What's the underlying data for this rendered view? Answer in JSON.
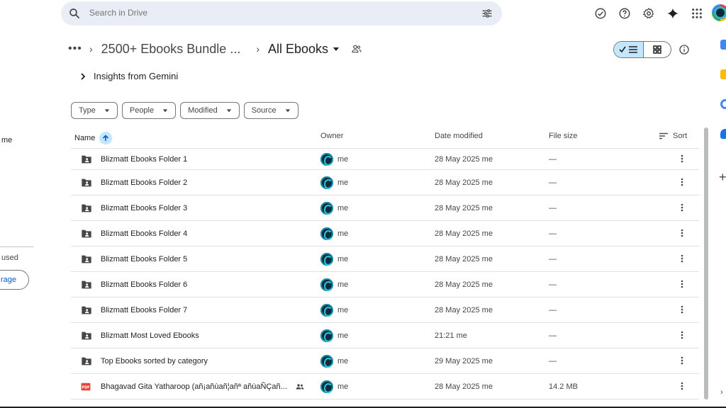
{
  "search": {
    "placeholder": "Search in Drive"
  },
  "sidebar": {
    "shared_label": "me",
    "storage_used": "used",
    "storage_button": "rage"
  },
  "breadcrumb": {
    "parent": "2500+ Ebooks Bundle ...",
    "current": "All Ebooks"
  },
  "gemini": {
    "label": "Insights from Gemini"
  },
  "filters": [
    {
      "label": "Type"
    },
    {
      "label": "People"
    },
    {
      "label": "Modified"
    },
    {
      "label": "Source"
    }
  ],
  "table": {
    "headers": {
      "name": "Name",
      "owner": "Owner",
      "date": "Date modified",
      "size": "File size",
      "sort": "Sort"
    },
    "rows": [
      {
        "type": "shared-folder",
        "name": "Blizmatt Ebooks Folder 1",
        "owner": "me",
        "date": "28 May 2025 me",
        "size": "—"
      },
      {
        "type": "shared-folder",
        "name": "Blizmatt Ebooks Folder 2",
        "owner": "me",
        "date": "28 May 2025 me",
        "size": "—"
      },
      {
        "type": "shared-folder",
        "name": "Blizmatt Ebooks Folder 3",
        "owner": "me",
        "date": "28 May 2025 me",
        "size": "—"
      },
      {
        "type": "shared-folder",
        "name": "Blizmatt Ebooks Folder 4",
        "owner": "me",
        "date": "28 May 2025 me",
        "size": "—"
      },
      {
        "type": "shared-folder",
        "name": "Blizmatt Ebooks Folder 5",
        "owner": "me",
        "date": "28 May 2025 me",
        "size": "—"
      },
      {
        "type": "shared-folder",
        "name": "Blizmatt Ebooks Folder 6",
        "owner": "me",
        "date": "28 May 2025 me",
        "size": "—"
      },
      {
        "type": "shared-folder",
        "name": "Blizmatt Ebooks Folder 7",
        "owner": "me",
        "date": "28 May 2025 me",
        "size": "—"
      },
      {
        "type": "shared-folder",
        "name": "Blizmatt Most Loved Ebooks",
        "owner": "me",
        "date": "21:21 me",
        "size": "—"
      },
      {
        "type": "shared-folder",
        "name": "Top Ebooks sorted by category",
        "owner": "me",
        "date": "29 May 2025 me",
        "size": "—"
      },
      {
        "type": "pdf",
        "name": "Bhagavad Gita Yatharoop (añ¡añùañ¦añª añùaÑÇañ...",
        "owner": "me",
        "date": "28 May 2025 me",
        "size": "14.2 MB",
        "shared": true
      }
    ]
  },
  "icons": {
    "search": "search-icon",
    "tune": "tune-icon",
    "ready_offline": "offline-check-icon",
    "help": "help-icon",
    "settings": "gear-icon",
    "gemini": "gemini-sparkle-icon",
    "apps": "apps-grid-icon",
    "folder": "shared-folder-icon",
    "pdf": "pdf-icon"
  },
  "colors": {
    "accent": "#c2e7ff",
    "search_bg": "#e9eef6",
    "pdf_red": "#ea4335",
    "folder": "#444746"
  }
}
